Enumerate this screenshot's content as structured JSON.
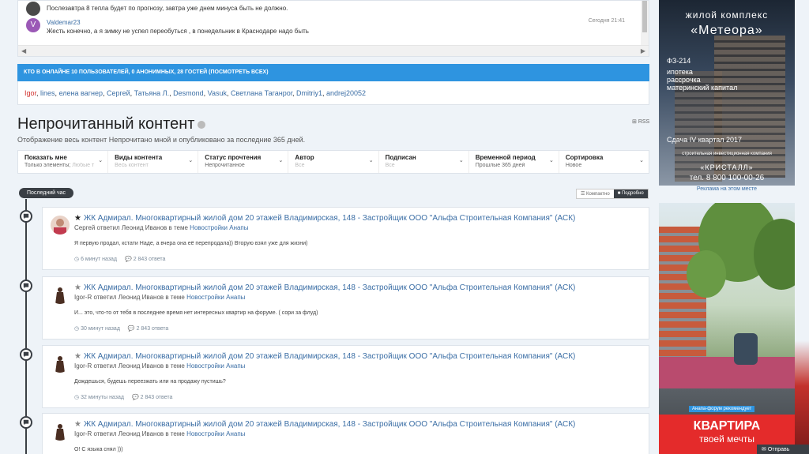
{
  "chat": {
    "messages": [
      {
        "author": "",
        "text": "Послезавтра 8 тепла будет по прогнозу, завтра уже днем минуса быть не должно.",
        "time": ""
      },
      {
        "author": "Valdemar23",
        "avatar_letter": "V",
        "text": "Жесть конечно, а я зимку не успел переобуться , в понедельник в Краснодаре надо быть",
        "time": "Сегодня 21:41"
      }
    ]
  },
  "online": {
    "header": "КТО В ОНЛАЙНЕ   10 ПОЛЬЗОВАТЕЛЕЙ, 0 АНОНИМНЫХ, 28 ГОСТЕЙ (ПОСМОТРЕТЬ ВСЕХ)",
    "users": [
      "Igor",
      "lines",
      "елена вагнер",
      "Сергей",
      "Татьяна Л.",
      "Desmond",
      "Vasuk",
      "Светлана Таганрог",
      "Dmitriy1",
      "andrej20052"
    ]
  },
  "page": {
    "title": "Непрочитанный контент",
    "subtitle": "Отображение весь контент Непрочитано мной и опубликовано за последние 365 дней.",
    "rss": "RSS"
  },
  "filters": [
    {
      "label": "Показать мне",
      "value": "Только элементы;",
      "placeholder": "Любые т"
    },
    {
      "label": "Виды контента",
      "value": "",
      "placeholder": "Весь контент"
    },
    {
      "label": "Статус прочтения",
      "value": "Непрочитанное",
      "placeholder": ""
    },
    {
      "label": "Автор",
      "value": "",
      "placeholder": "Все"
    },
    {
      "label": "Подписан",
      "value": "",
      "placeholder": "Все"
    },
    {
      "label": "Временной период",
      "value": "Прошлые 365 дней",
      "placeholder": ""
    },
    {
      "label": "Сортировка",
      "value": "Новое",
      "placeholder": ""
    }
  ],
  "timeline": {
    "pill": "Последний час",
    "view_compact": "Компактно",
    "view_detailed": "Подробно"
  },
  "items": [
    {
      "title": "ЖК Адмирал. Многоквартирный жилой дом 20 этажей Владимирская, 148 - Застройщик ООО \"Альфа Строительная Компания\" (АСК)",
      "subline": "Сергей ответил Леонид Иванов в теме",
      "forum": "Новостройки Анапы",
      "body": "Я первую продал, кстати Наде, а вчера она её перепродала)) Вторую взял уже для жизни)",
      "time": "6 минут назад",
      "replies": "2 843 ответа",
      "starred": true
    },
    {
      "title": "ЖК Адмирал. Многоквартирный жилой дом 20 этажей Владимирская, 148 - Застройщик ООО \"Альфа Строительная Компания\" (АСК)",
      "subline": "Igor-R ответил Леонид Иванов в теме",
      "forum": "Новостройки Анапы",
      "body": "И... это, что-то от тебя в последнее время нет интересных квартир на форуме. ( сори за флуд)",
      "time": "30 минут назад",
      "replies": "2 843 ответа",
      "starred": false
    },
    {
      "title": "ЖК Адмирал. Многоквартирный жилой дом 20 этажей Владимирская, 148 - Застройщик ООО \"Альфа Строительная Компания\" (АСК)",
      "subline": "Igor-R ответил Леонид Иванов в теме",
      "forum": "Новостройки Анапы",
      "body": "Дождешься, будешь переезжать или на продажу пустишь?",
      "time": "32 минуты назад",
      "replies": "2 843 ответа",
      "starred": false
    },
    {
      "title": "ЖК Адмирал. Многоквартирный жилой дом 20 этажей Владимирская, 148 - Застройщик ООО \"Альфа Строительная Компания\" (АСК)",
      "subline": "Igor-R ответил Леонид Иванов в теме",
      "forum": "Новостройки Анапы",
      "body": "О! С языка снял )))",
      "time": "",
      "replies": "",
      "starred": false
    }
  ],
  "ads": {
    "meteora": {
      "line1": "жилой комплекс",
      "line2": "«Метеора»",
      "l1": "ФЗ-214",
      "l2": "ипотека",
      "l3": "рассрочка",
      "l4": "материнский капитал",
      "deadline": "Сдача  IV квартал 2017",
      "developer_small": "строительная\nинвестиционная компания",
      "developer": "«КРИСТАЛЛ»",
      "phone": "тел. 8 800 100-00-26"
    },
    "caption": "Реклама на этом месте",
    "recommend": "Анапа-форум рекомендует",
    "banner_line1": "КВАРТИРА",
    "banner_line2": "твоей мечты"
  },
  "footer_chat": "Отправь"
}
